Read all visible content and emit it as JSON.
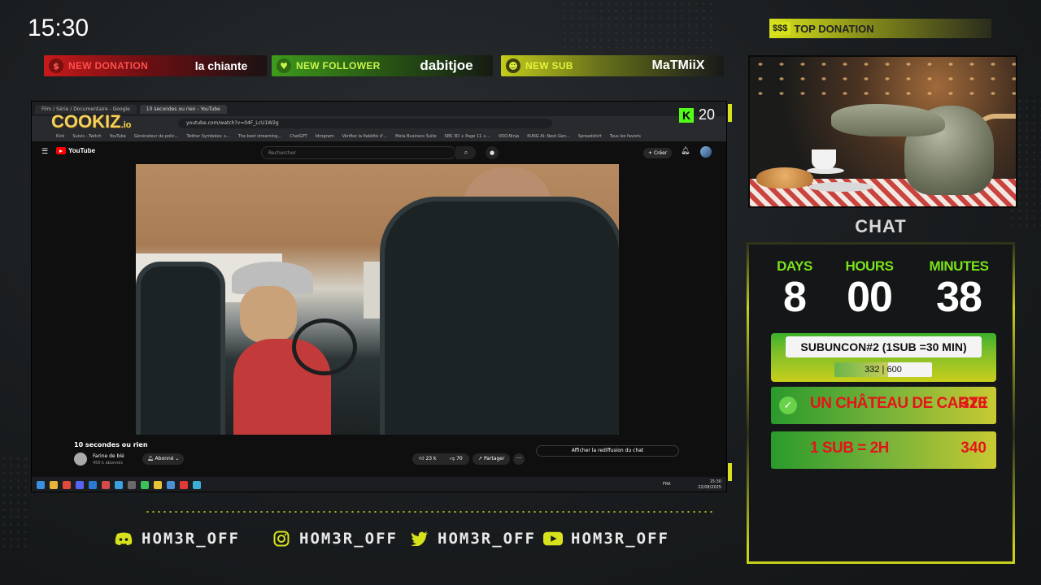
{
  "clock": "15:30",
  "alerts": {
    "donation": {
      "label": "NEW DONATION",
      "value": "la chiante",
      "icon": "dollar-icon"
    },
    "follower": {
      "label": "NEW FOLLOWER",
      "value": "dabitjoe",
      "icon": "heart-icon"
    },
    "sub": {
      "label": "NEW SUB",
      "value": "MaTMiiX",
      "icon": "users-icon"
    }
  },
  "top_donation": {
    "badge": "$$$",
    "label": "TOP DONATION"
  },
  "screen": {
    "tabs": [
      "Film / Série / Documentaire - Google",
      "10 secondes ou rien - YouTube"
    ],
    "url": "youtube.com/watch?v=04F_LcU1W2g",
    "bookmarks": [
      "Kick",
      "Suivis - Twitch",
      "YouTube",
      "Générateur de polic...",
      "Twitter Symboles: s...",
      "The best streaming...",
      "ChatGPT",
      "Idrogram",
      "Vérifiez la fiabilité d'...",
      "Meta Business Suite",
      "SBS 3D + Page 11 +...",
      "VDO.Ninja",
      "KUNG AI: Next-Gen...",
      "Spreadshirt",
      "Tous les favoris"
    ],
    "youtube_logo": "YouTube",
    "search_placeholder": "Rechercher",
    "create_label": "Créer",
    "video_title": "10 secondes ou rien",
    "channel_name": "Farine de blé",
    "channel_subs": "450 k abonnés",
    "subscribed_label": "Abonné",
    "likes": "23 k",
    "dislikes": "70",
    "share_label": "Partager",
    "replay_label": "Afficher la rediffusion du chat",
    "taskbar_time": "15:30",
    "taskbar_date": "22/08/2025",
    "lang": "FRA"
  },
  "cookiz": {
    "name": "COOKIZ",
    "suffix": ".io"
  },
  "kick": {
    "letter": "K",
    "viewers": "20"
  },
  "socials": [
    {
      "icon": "discord-icon",
      "handle": "HOM3R_OFF"
    },
    {
      "icon": "instagram-icon",
      "handle": "HOM3R_OFF"
    },
    {
      "icon": "twitter-icon",
      "handle": "HOM3R_OFF"
    },
    {
      "icon": "youtube-icon",
      "handle": "HOM3R_OFF"
    }
  ],
  "chat_label": "CHAT",
  "timer": {
    "days_label": "DAYS",
    "days": "8",
    "hours_label": "HOURS",
    "hours": "00",
    "minutes_label": "MINUTES",
    "minutes": "38"
  },
  "subathon": {
    "title": "SUBUNCON#2 (1SUB =30 MIN)",
    "current": "332",
    "goal": "600",
    "progress": 0.553
  },
  "goals": [
    {
      "name": "UN CHÂTEAU DE CARTE",
      "value": "320",
      "done": true
    },
    {
      "name": "1 SUB = 2H",
      "value": "340",
      "done": false
    }
  ],
  "colors": {
    "accent_yellow": "#d8e21c",
    "timer_green": "#79e21a",
    "goal_red": "#e4151a",
    "kick_green": "#53fc18"
  }
}
